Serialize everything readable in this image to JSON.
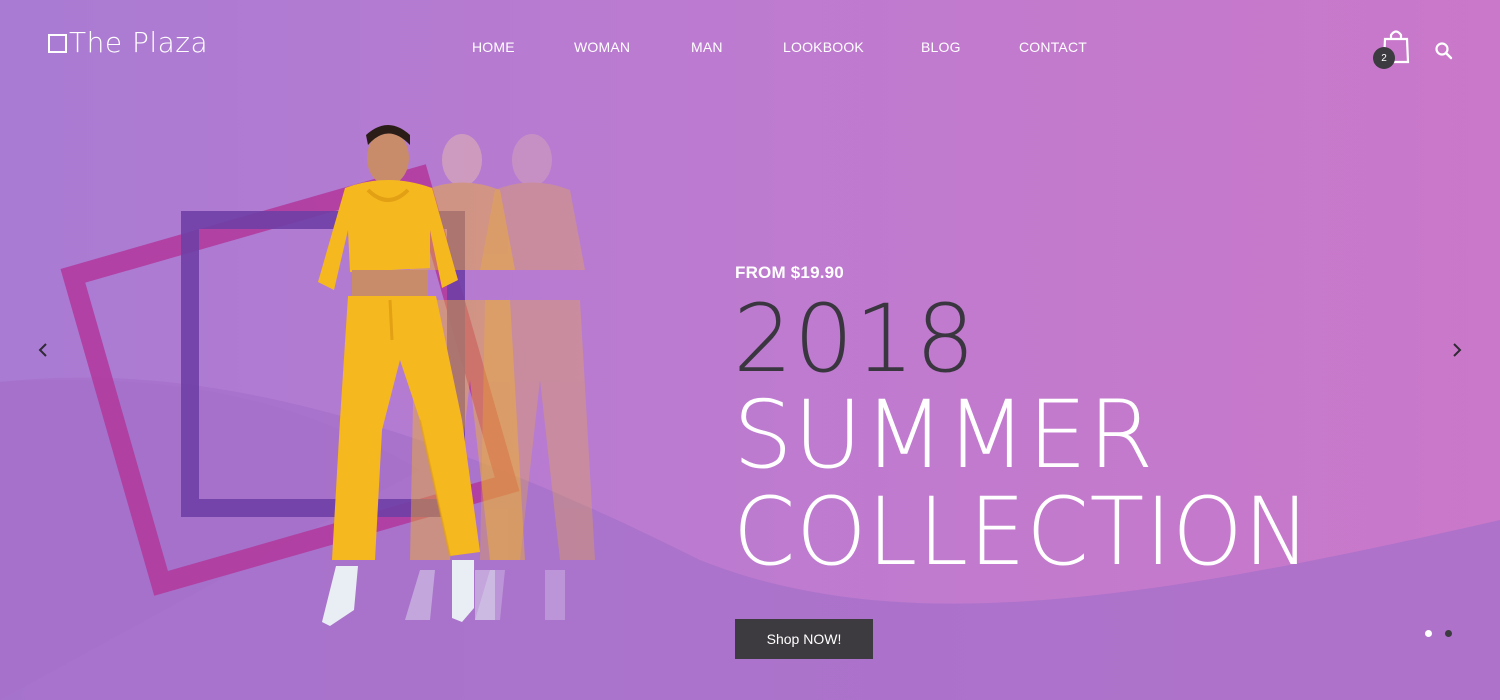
{
  "brand": {
    "name": "The Plaza"
  },
  "nav": {
    "items": [
      {
        "label": "HOME"
      },
      {
        "label": "WOMAN"
      },
      {
        "label": "MAN"
      },
      {
        "label": "LOOKBOOK"
      },
      {
        "label": "BLOG"
      },
      {
        "label": "CONTACT"
      }
    ]
  },
  "header": {
    "cart_count": "2",
    "cart_icon": "shopping-bag-icon",
    "search_icon": "search-icon"
  },
  "slider": {
    "price_text": "FROM $19.90",
    "year": "2018",
    "line1": "SUMMER",
    "line2": "COLLECTION",
    "cta_label": "Shop NOW!",
    "prev_icon": "chevron-left-icon",
    "next_icon": "chevron-right-icon",
    "slide_count": 2,
    "active_slide": 1
  },
  "colors": {
    "background_start": "#a97bd3",
    "background_end": "#ca78c9",
    "dark": "#3e3b40",
    "accent_square": "#6f3fa6",
    "accent_frame": "#b2379b",
    "outfit": "#f6b81f"
  }
}
